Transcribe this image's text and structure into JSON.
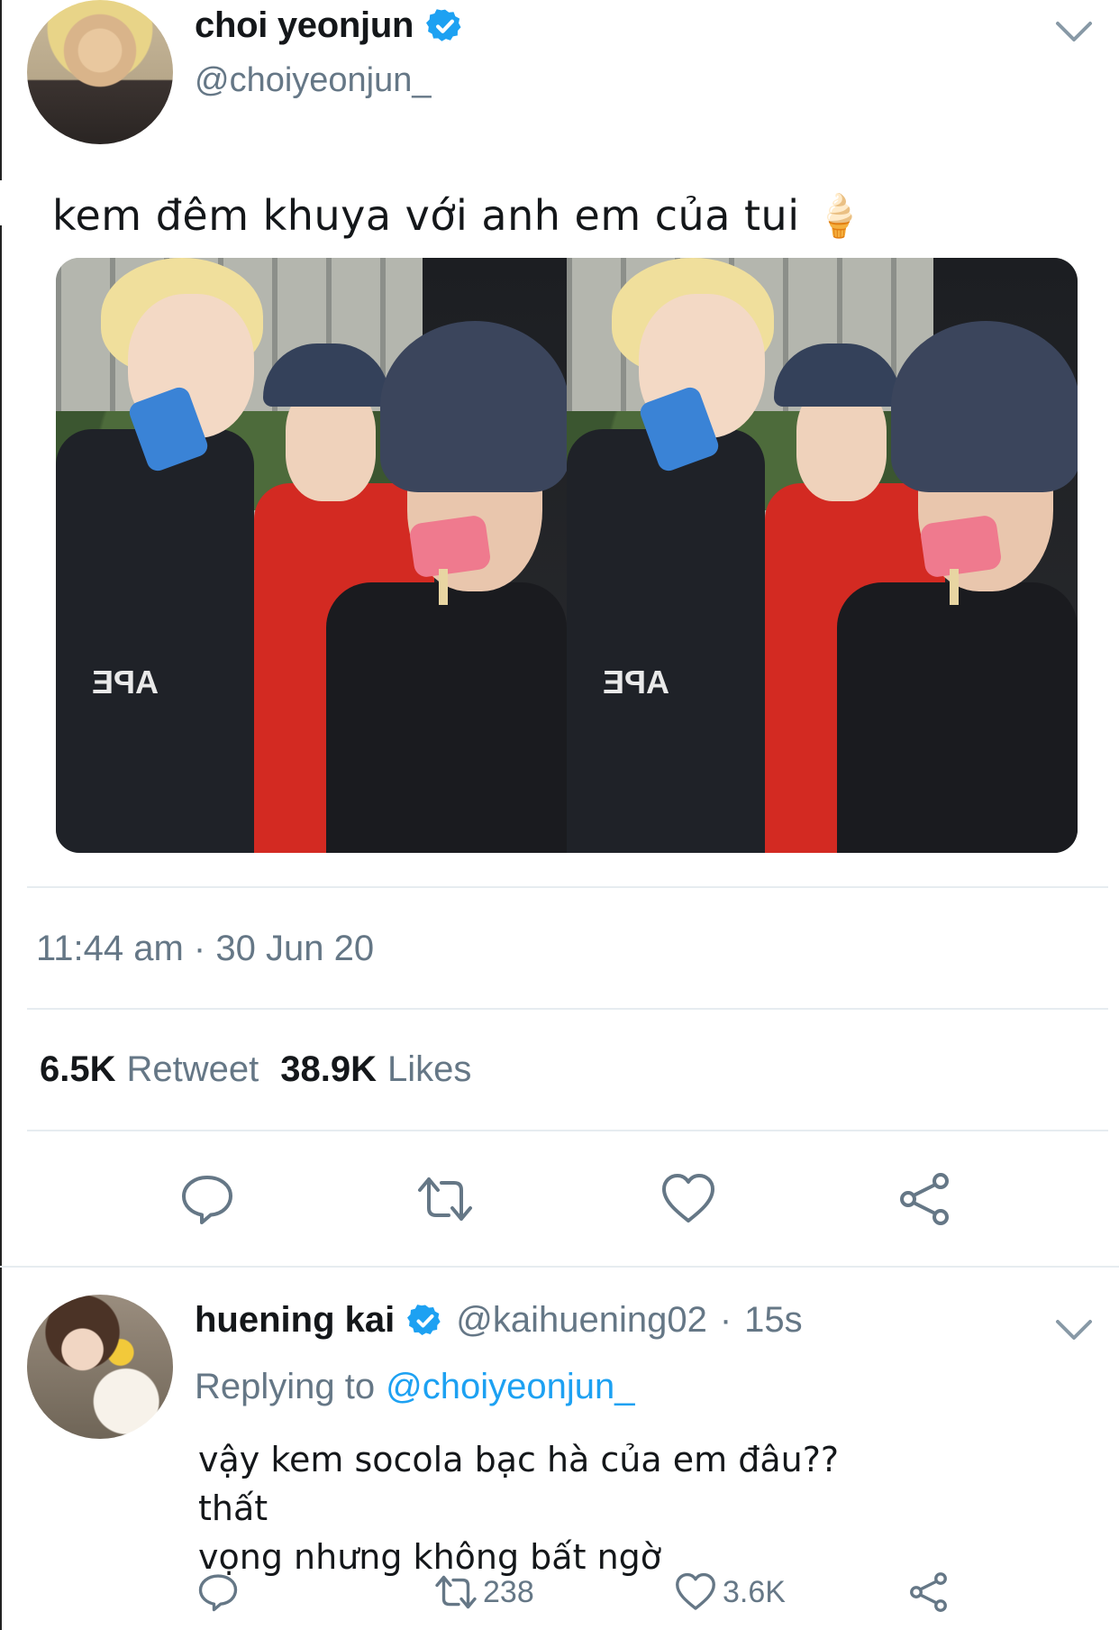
{
  "tweet": {
    "author_name": "choi yeonjun",
    "author_handle": "@choiyeonjun_",
    "text": "kem đêm khuya với anh em của tui 🍦",
    "timestamp": "11:44 am · 30 Jun 20",
    "retweets_count": "6.5K",
    "retweets_label": "Retweet",
    "likes_count": "38.9K",
    "likes_label": "Likes",
    "media_count": 2
  },
  "reply": {
    "author_name": "huening kai",
    "author_handle": "@kaihuening02",
    "separator": "·",
    "time": "15s",
    "replying_prefix": "Replying to",
    "replying_to": "@choiyeonjun_",
    "text_line1": "vậy kem socola bạc hà của em đâu?? thất",
    "text_line2": "vọng nhưng không bất ngờ",
    "retweets": "238",
    "likes": "3.6K"
  },
  "colors": {
    "accent": "#1da1f2",
    "secondary_text": "#657786",
    "divider": "#e6ecf0"
  },
  "icons": [
    "verified-badge",
    "chevron-down",
    "reply",
    "retweet",
    "like",
    "share"
  ]
}
